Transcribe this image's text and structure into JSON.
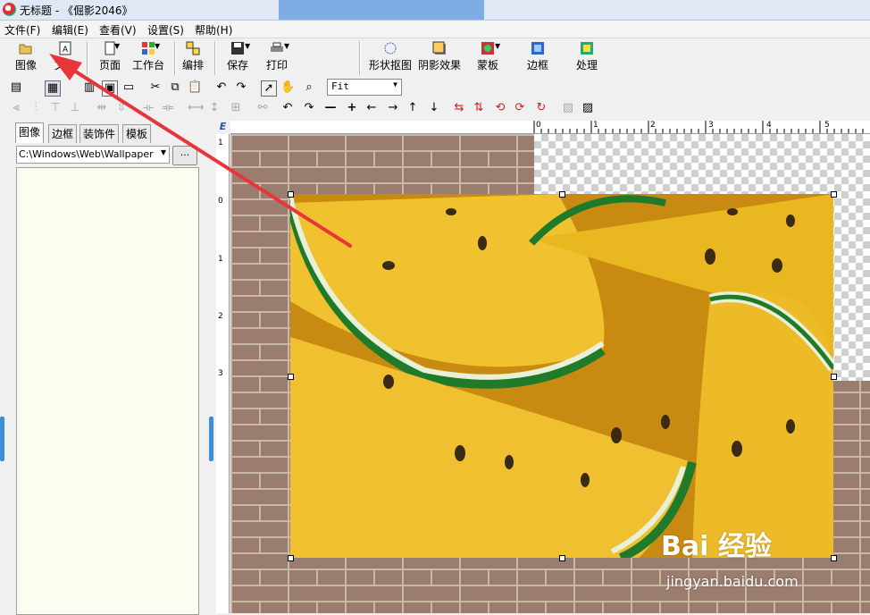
{
  "window": {
    "title": "无标题 - 《倔影2046》"
  },
  "menu": [
    "文件(F)",
    "编辑(E)",
    "查看(V)",
    "设置(S)",
    "帮助(H)"
  ],
  "toolbar_main": {
    "image": "图像",
    "text": "文本",
    "page": "页面",
    "workbench": "工作台",
    "arrange": "编排",
    "save": "保存",
    "print": "打印",
    "shape_cutout": "形状抠图",
    "shadow_effect": "阴影效果",
    "mask": "蒙板",
    "border": "边框",
    "process": "处理"
  },
  "zoom": {
    "value": "Fit"
  },
  "left_panel": {
    "tabs": [
      "图像",
      "边框",
      "装饰件",
      "模板"
    ],
    "path": "C:\\Windows\\Web\\Wallpaper",
    "browse_label": "..."
  },
  "rulers": {
    "h_labels": [
      "0",
      "1",
      "2",
      "3",
      "4",
      "5"
    ],
    "v_labels": [
      "1",
      "0",
      "1",
      "2",
      "3"
    ]
  },
  "watermark": {
    "brand": "Bai 经验",
    "url": "jingyan.baidu.com"
  },
  "colors": {
    "arrow": "#e8353a",
    "accent": "#3b8fd6"
  }
}
